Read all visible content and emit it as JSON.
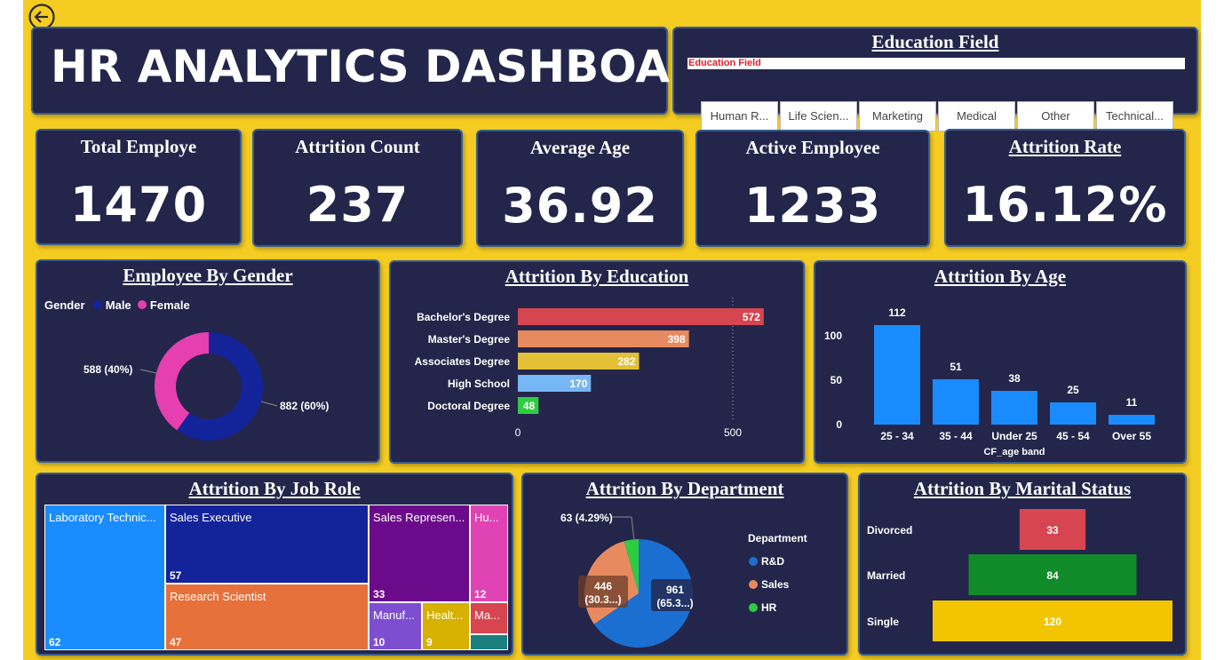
{
  "header": {
    "title": "HR ANALYTICS DASHBOARD"
  },
  "slicer": {
    "title": "Education Field",
    "field_label": "Education Field",
    "options": [
      "Human R...",
      "Life Scien...",
      "Marketing",
      "Medical",
      "Other",
      "Technical..."
    ]
  },
  "kpis": [
    {
      "title": "Total Employe",
      "value": "1470"
    },
    {
      "title": "Attrition Count",
      "value": "237"
    },
    {
      "title": "Average Age",
      "value": "36.92"
    },
    {
      "title": "Active Employee",
      "value": "1233"
    },
    {
      "title": "Attrition Rate",
      "value": "16.12%"
    }
  ],
  "colors": {
    "background": "#f5cc22",
    "panel": "#23264a",
    "panel_border": "#3a5d8f"
  },
  "chart_data": [
    {
      "type": "pie",
      "title": "Employee By Gender",
      "legend_title": "Gender",
      "categories": [
        "Male",
        "Female"
      ],
      "values": [
        882,
        588
      ],
      "data_labels": [
        "882 (60%)",
        "588 (40%)"
      ],
      "colors": [
        "#13239a",
        "#e63fb0"
      ],
      "donut": true,
      "legend_position": "top-left"
    },
    {
      "type": "bar",
      "orientation": "horizontal",
      "title": "Attrition By Education",
      "categories": [
        "Bachelor's Degree",
        "Master's Degree",
        "Associates Degree",
        "High School",
        "Doctoral Degree"
      ],
      "values": [
        572,
        398,
        282,
        170,
        48
      ],
      "colors": [
        "#d64550",
        "#e88a5f",
        "#e3c035",
        "#76b7f5",
        "#2ecc40"
      ],
      "xlim": [
        0,
        650
      ],
      "xticks": [
        0,
        500
      ],
      "grid": true
    },
    {
      "type": "bar",
      "title": "Attrition By Age",
      "xlabel": "CF_age band",
      "categories": [
        "25 - 34",
        "35 - 44",
        "Under 25",
        "45 - 54",
        "Over 55"
      ],
      "values": [
        112,
        51,
        38,
        25,
        11
      ],
      "color": "#1a8cff",
      "ylim": [
        0,
        120
      ],
      "yticks": [
        0,
        50,
        100
      ]
    },
    {
      "type": "treemap",
      "title": "Attrition By Job Role",
      "items": [
        {
          "name": "Laboratory Technic...",
          "value": 62,
          "label": "62",
          "color": "#1a8cff"
        },
        {
          "name": "Sales Executive",
          "value": 57,
          "label": "57",
          "color": "#13239a"
        },
        {
          "name": "Research Scientist",
          "value": 47,
          "label": "47",
          "color": "#e8703a"
        },
        {
          "name": "Sales Represen...",
          "value": 33,
          "label": "33",
          "color": "#6b0a8a"
        },
        {
          "name": "Hu...",
          "value": 12,
          "label": "12",
          "color": "#e043b3"
        },
        {
          "name": "Manuf...",
          "value": 10,
          "label": "10",
          "color": "#7d4fd0"
        },
        {
          "name": "Healt...",
          "value": 9,
          "label": "9",
          "color": "#d6b100"
        },
        {
          "name": "Ma...",
          "value": 5,
          "label": "",
          "color": "#d64550"
        },
        {
          "name": "",
          "value": 2,
          "label": "",
          "color": "#1b7f7f"
        }
      ]
    },
    {
      "type": "pie",
      "title": "Attrition By Department",
      "legend_title": "Department",
      "categories": [
        "R&D",
        "Sales",
        "HR"
      ],
      "values": [
        961,
        446,
        63
      ],
      "data_labels": [
        "961\n(65.3...)",
        "446\n(30.3...)",
        "63 (4.29%)"
      ],
      "colors": [
        "#1a6fd1",
        "#e88a5f",
        "#2ecc40"
      ],
      "legend_position": "right"
    },
    {
      "type": "bar",
      "orientation": "horizontal",
      "style": "funnel",
      "title": "Attrition By Marital Status",
      "categories": [
        "Divorced",
        "Married",
        "Single"
      ],
      "values": [
        33,
        84,
        120
      ],
      "colors": [
        "#d64550",
        "#118a2a",
        "#f2c500"
      ]
    }
  ]
}
